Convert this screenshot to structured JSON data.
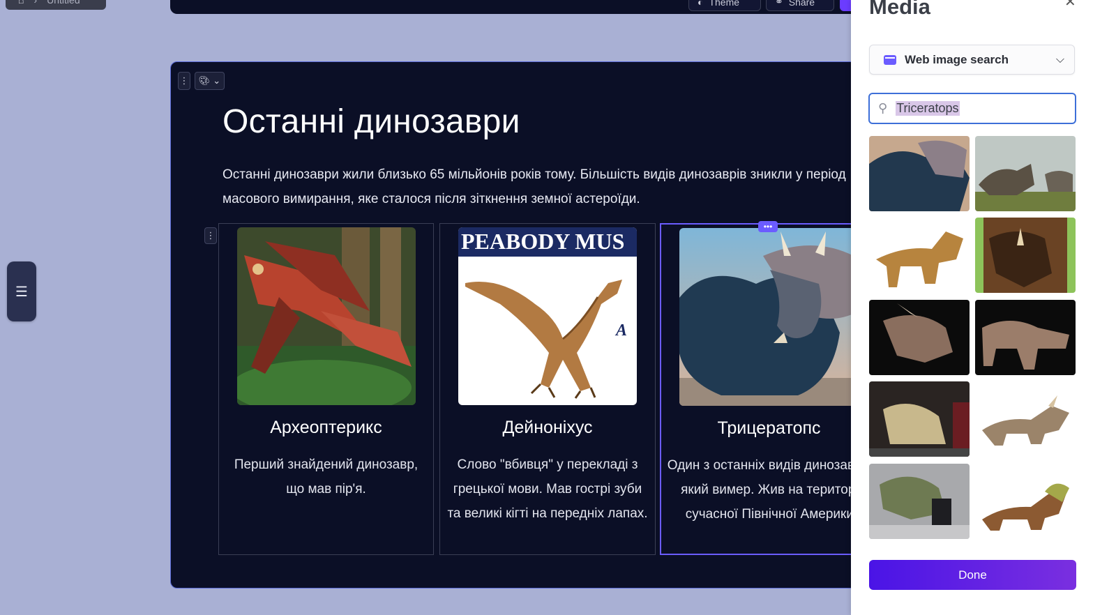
{
  "breadcrumb": {
    "text": "Untitled"
  },
  "topbar": {
    "theme_label": "Theme",
    "share_label": "Share"
  },
  "slide": {
    "title": "Останні динозаври",
    "lead": "Останні динозаври жили близько 65 мільйонів років тому. Більшість видів динозаврів зникли у період масового вимирання, яке сталося після зіткнення земної астероїди.",
    "columns": [
      {
        "heading": "Археоптерикс",
        "text": "Перший знайдений динозавр, що мав пір'я."
      },
      {
        "heading": "Дейноніхус",
        "text": "Слово \"вбивця\" у перекладі з грецької мови. Мав гострі зуби та великі кігті на передніх лапах.",
        "image_caption": "PEABODY MUS"
      },
      {
        "heading": "Трицератопс",
        "text": "Один з останніх видів динозаврів, який вимер. Жив на території сучасної Північної Америки."
      }
    ]
  },
  "media_panel": {
    "title": "Media",
    "source": "Web image search",
    "search_value": "Triceratops",
    "done_label": "Done"
  },
  "colors": {
    "accent": "#6b5cff",
    "slide_bg": "#0b0f26",
    "canvas_bg": "#a9b0d4",
    "done_start": "#4a14e6",
    "done_end": "#7a2fe0"
  }
}
